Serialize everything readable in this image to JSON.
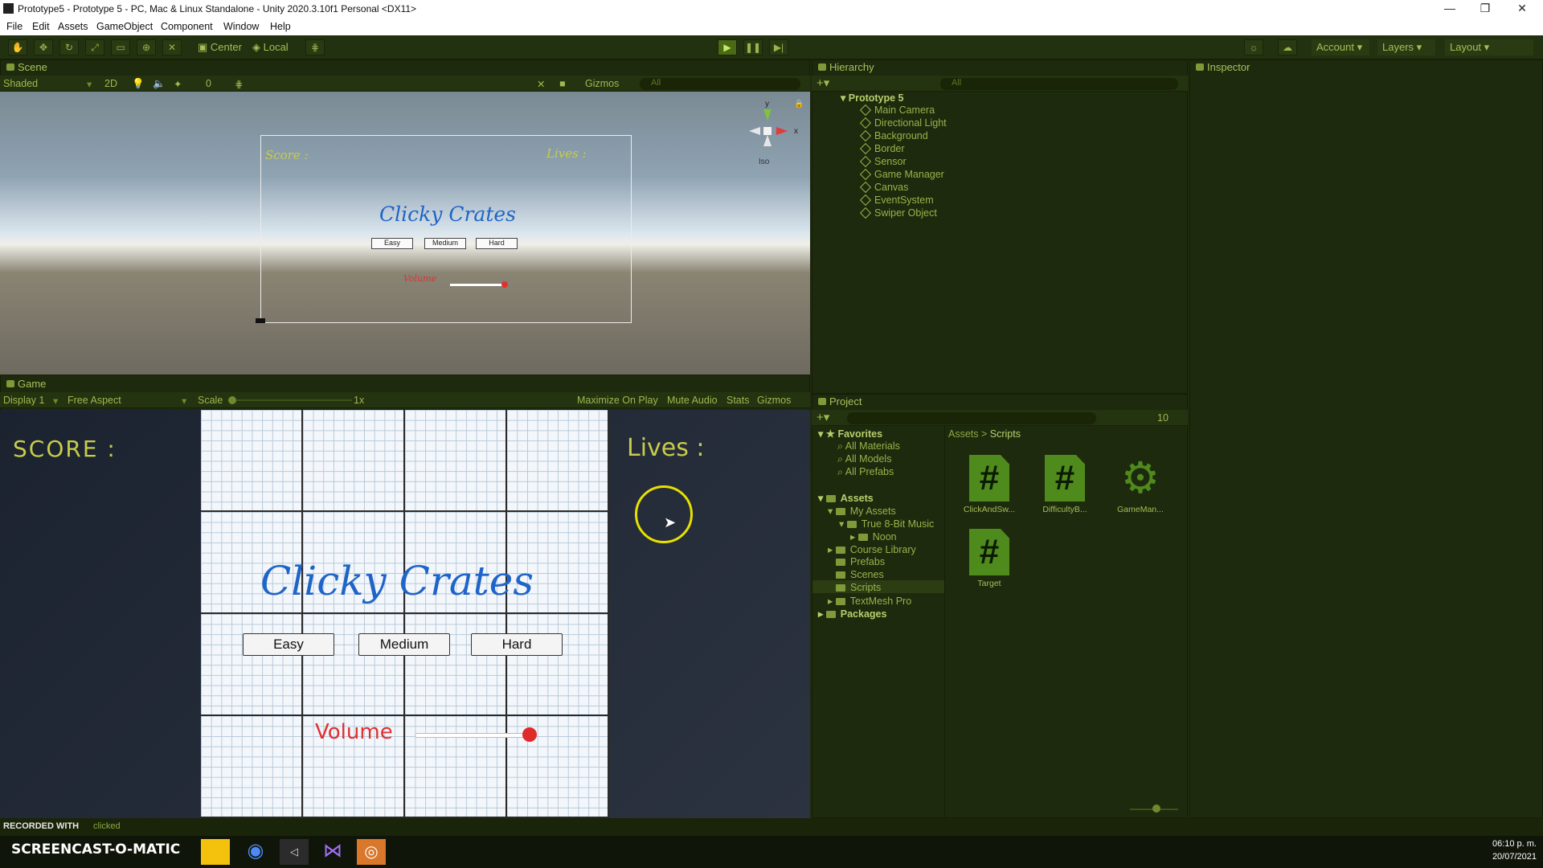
{
  "window": {
    "title": "Prototype5 - Prototype 5 - PC, Mac & Linux Standalone - Unity 2020.3.10f1 Personal <DX11>",
    "min": "—",
    "max": "❐",
    "close": "✕"
  },
  "menu": [
    "File",
    "Edit",
    "Assets",
    "GameObject",
    "Component",
    "Window",
    "Help"
  ],
  "toolbar": {
    "center": "Center",
    "local": "Local",
    "account": "Account",
    "layers": "Layers",
    "layout": "Layout"
  },
  "scene": {
    "tab": "Scene",
    "shading": "Shaded",
    "mode2d": "2D",
    "hidden_count": "0",
    "gizmos": "Gizmos",
    "search_placeholder": "All",
    "iso": "Iso",
    "axis_y": "y",
    "axis_x": "x",
    "ui": {
      "score": "Score :",
      "lives": "Lives :",
      "title": "Clicky Crates",
      "easy": "Easy",
      "medium": "Medium",
      "hard": "Hard",
      "volume": "Volume"
    }
  },
  "game": {
    "tab": "Game",
    "display": "Display 1",
    "aspect": "Free Aspect",
    "scale_label": "Scale",
    "scale_value": "1x",
    "maximize": "Maximize On Play",
    "mute": "Mute Audio",
    "stats": "Stats",
    "gizmos": "Gizmos",
    "score": "SCORE :",
    "lives": "Lives :",
    "title": "Clicky Crates",
    "easy": "Easy",
    "medium": "Medium",
    "hard": "Hard",
    "volume": "Volume",
    "volume_level": 0.95
  },
  "hierarchy": {
    "tab": "Hierarchy",
    "search_placeholder": "All",
    "root": "Prototype 5",
    "items": [
      "Main Camera",
      "Directional Light",
      "Background",
      "Border",
      "Sensor",
      "Game Manager",
      "Canvas",
      "EventSystem",
      "Swiper Object"
    ]
  },
  "inspector": {
    "tab": "Inspector"
  },
  "project": {
    "tab": "Project",
    "hidden_count": "10",
    "favorites": {
      "label": "Favorites",
      "items": [
        "All Materials",
        "All Models",
        "All Prefabs"
      ]
    },
    "assets_label": "Assets",
    "tree": [
      "My Assets",
      "True 8-Bit Music",
      "Noon",
      "Course Library",
      "Prefabs",
      "Scenes",
      "Scripts",
      "TextMesh Pro"
    ],
    "packages": "Packages",
    "breadcrumb": [
      "Assets",
      "Scripts"
    ],
    "files": [
      "ClickAndSw...",
      "DifficultyB...",
      "GameMan...",
      "Target"
    ]
  },
  "status": {
    "recorded": "RECORDED WITH",
    "clicked": "clicked",
    "brand": "SCREENCAST-O-MATIC"
  },
  "taskbar": {
    "time": "06:10 p. m.",
    "date": "20/07/2021"
  },
  "colors": {
    "accent": "#b9cf6e",
    "panel": "#1e2a0d",
    "score_text": "#c8cc4a",
    "title_text": "#1f64c8",
    "volume_text": "#e03030"
  }
}
